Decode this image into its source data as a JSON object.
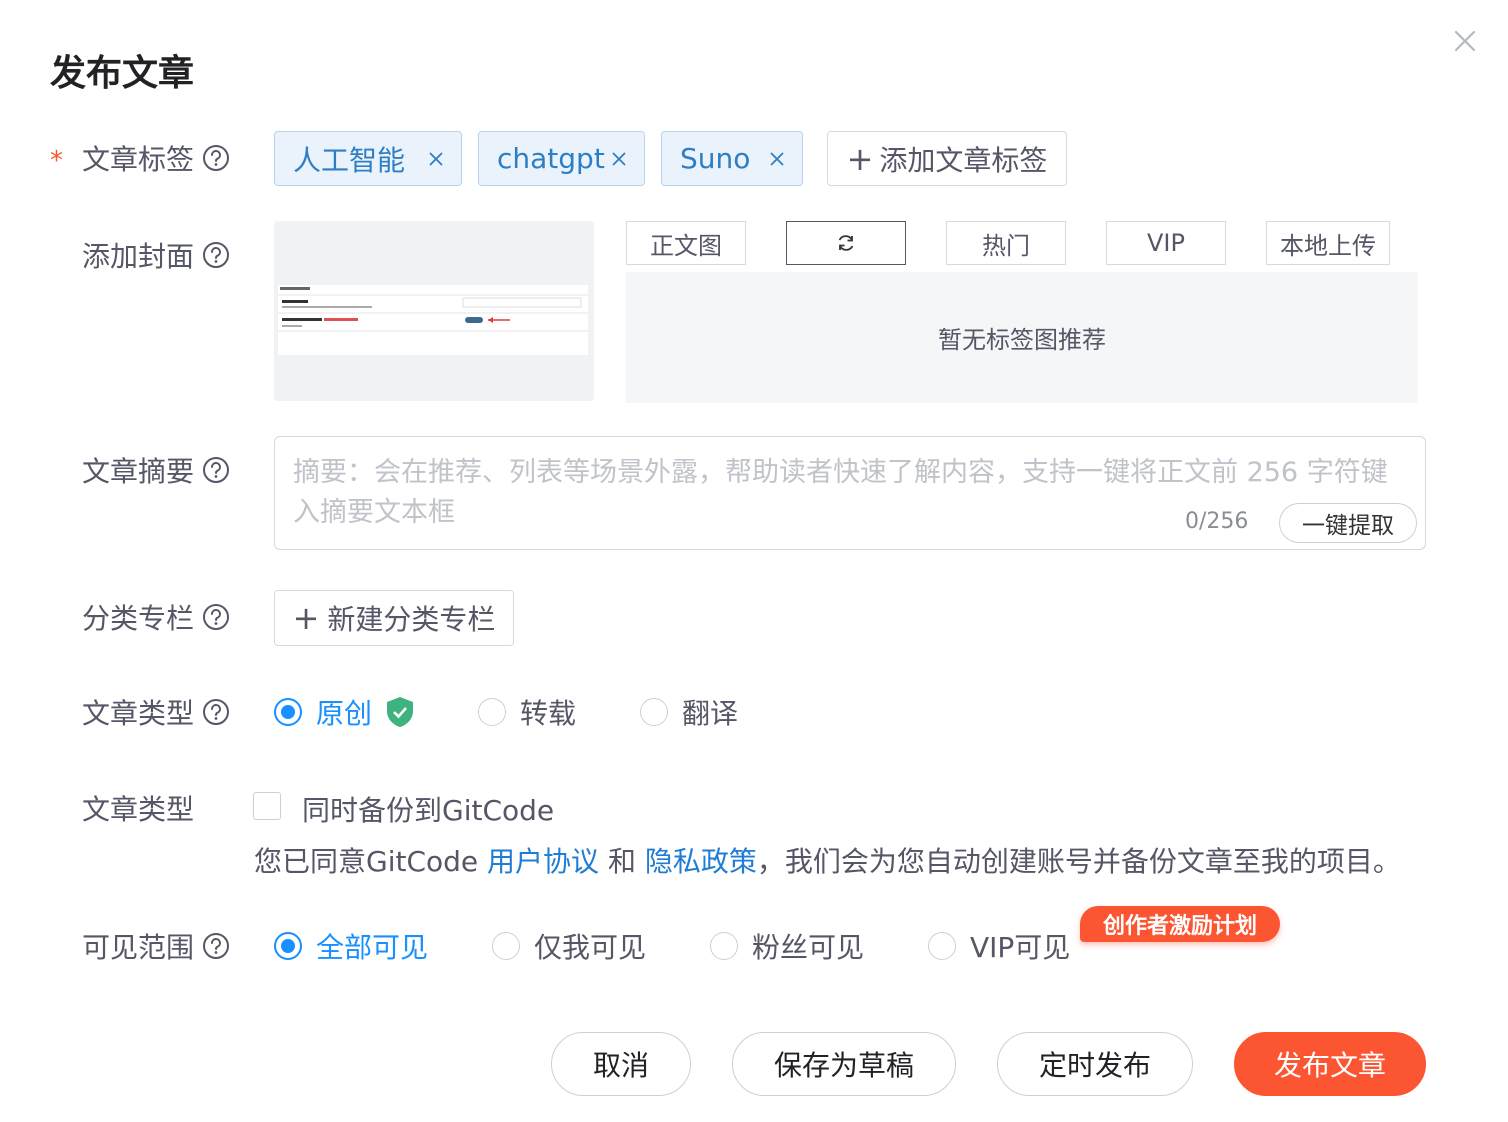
{
  "dialog": {
    "title": "发布文章"
  },
  "labels": {
    "tags": "文章标签",
    "cover": "添加封面",
    "summary": "文章摘要",
    "column": "分类专栏",
    "article_type": "文章类型",
    "backup": "文章类型",
    "visibility": "可见范围",
    "required_mark": "*"
  },
  "tags": [
    "人工智能",
    "chatgpt",
    "Suno"
  ],
  "add_tag_label": "添加文章标签",
  "cover": {
    "tabs": [
      "正文图",
      "",
      "热门",
      "VIP",
      "本地上传"
    ],
    "empty_text": "暂无标签图推荐"
  },
  "summary": {
    "placeholder": "摘要：会在推荐、列表等场景外露，帮助读者快速了解内容，支持一键将正文前 256 字符键入摘要文本框",
    "count": "0/256",
    "extract_label": "一键提取"
  },
  "column": {
    "new_label": "新建分类专栏"
  },
  "article_type": {
    "options": [
      "原创",
      "转载",
      "翻译"
    ],
    "selected": "原创"
  },
  "backup": {
    "checkbox_label": "同时备份到GitCode",
    "checked": false,
    "note_prefix": "您已同意GitCode ",
    "link_agreement": "用户协议",
    "and": " 和 ",
    "link_privacy": "隐私政策",
    "note_suffix": "，我们会为您自动创建账号并备份文章至我的项目。"
  },
  "visibility": {
    "options": [
      "全部可见",
      "仅我可见",
      "粉丝可见",
      "VIP可见"
    ],
    "selected": "全部可见",
    "badge": "创作者激励计划"
  },
  "buttons": {
    "cancel": "取消",
    "save_draft": "保存为草稿",
    "schedule": "定时发布",
    "publish": "发布文章"
  },
  "colors": {
    "accent": "#fc5531",
    "link": "#1f7dd3",
    "radio": "#1890ff",
    "tag_bg": "#eaf3fc"
  }
}
